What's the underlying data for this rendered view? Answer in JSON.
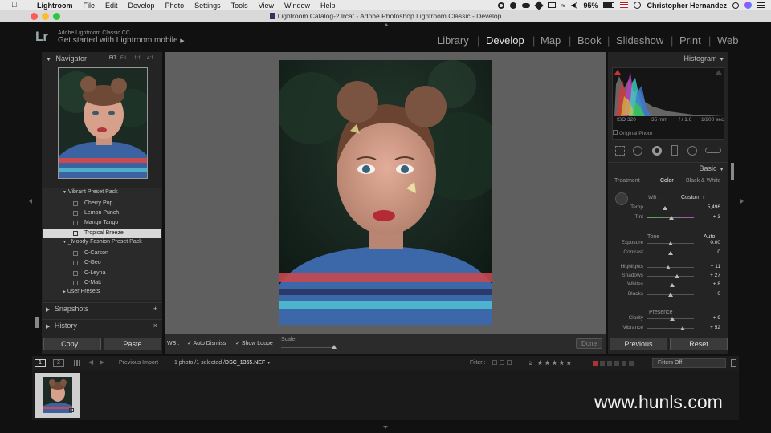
{
  "menubar": {
    "items": [
      "Lightroom",
      "File",
      "Edit",
      "Develop",
      "Photo",
      "Settings",
      "Tools",
      "View",
      "Window",
      "Help"
    ],
    "battery": "95%",
    "user": "Christopher Hernandez"
  },
  "window": {
    "title": "Lightroom Catalog-2.lrcat - Adobe Photoshop Lightroom Classic - Develop"
  },
  "identity": {
    "logo": "Lr",
    "product": "Adobe Lightroom Classic CC",
    "mobile": "Get started with Lightroom mobile"
  },
  "modules": [
    "Library",
    "Develop",
    "Map",
    "Book",
    "Slideshow",
    "Print",
    "Web"
  ],
  "modules_seps": [
    "|",
    "|",
    "|",
    "|",
    "|",
    "|"
  ],
  "active_module": "Develop",
  "navigator": {
    "title": "Navigator",
    "zoom": [
      "FIT",
      "FILL",
      "1:1",
      "4:1"
    ]
  },
  "presets": {
    "groups": [
      {
        "name": "Vibrant Preset Pack",
        "items": [
          "Cherry Pop",
          "Lemon Punch",
          "Mango Tango",
          "Tropical Breeze"
        ]
      },
      {
        "name": "_Moody-Fashion Preset Pack",
        "items": [
          "C-Carson",
          "C-Geo",
          "C-Leyna",
          "C-Matt"
        ]
      },
      {
        "name": "User Presets",
        "items": []
      }
    ],
    "selected": "Tropical Breeze"
  },
  "snapshots": {
    "title": "Snapshots",
    "add": "+"
  },
  "history": {
    "title": "History",
    "clear": "×"
  },
  "left_buttons": {
    "copy": "Copy...",
    "paste": "Paste"
  },
  "toolbar": {
    "wb": "WB :",
    "auto_dismiss": "Auto Dismiss",
    "show_loupe": "Show Loupe",
    "scale": "Scale",
    "done": "Done"
  },
  "histogram": {
    "title": "Histogram",
    "iso": "ISO 320",
    "focal": "35 mm",
    "aperture": "f / 1.6",
    "shutter": "1/200 sec",
    "original": "Original Photo"
  },
  "basic": {
    "title": "Basic",
    "treatment_label": "Treatment :",
    "color": "Color",
    "bw": "Black & White",
    "wb_label": "WB :",
    "wb_value": "Custom",
    "tone_label": "Tone",
    "auto": "Auto",
    "presence_label": "Presence",
    "sliders": [
      {
        "label": "Temp",
        "value": "5,496",
        "pos": 0.38
      },
      {
        "label": "Tint",
        "value": "+ 3",
        "pos": 0.52
      },
      {
        "label": "Exposure",
        "value": "0.00",
        "pos": 0.5
      },
      {
        "label": "Contrast",
        "value": "0",
        "pos": 0.5
      },
      {
        "label": "Highlights",
        "value": "− 11",
        "pos": 0.45
      },
      {
        "label": "Shadows",
        "value": "+ 27",
        "pos": 0.63
      },
      {
        "label": "Whites",
        "value": "+ 8",
        "pos": 0.54
      },
      {
        "label": "Blacks",
        "value": "0",
        "pos": 0.5
      },
      {
        "label": "Clarity",
        "value": "+ 9",
        "pos": 0.54
      },
      {
        "label": "Vibrance",
        "value": "+ 52",
        "pos": 0.76
      }
    ]
  },
  "right_buttons": {
    "previous": "Previous",
    "reset": "Reset"
  },
  "filmstrip": {
    "view1": "1",
    "view2": "2",
    "source": "Previous Import",
    "count": "1 photo /1 selected /",
    "file": "DSC_1365.NEF",
    "filter_label": "Filter :",
    "rating_op": "≥",
    "filters_off": "Filters Off"
  },
  "watermark": "www.hunls.com",
  "colors": {
    "bg": "#111111",
    "panel": "#242424",
    "workspace": "#5f5f5f"
  }
}
